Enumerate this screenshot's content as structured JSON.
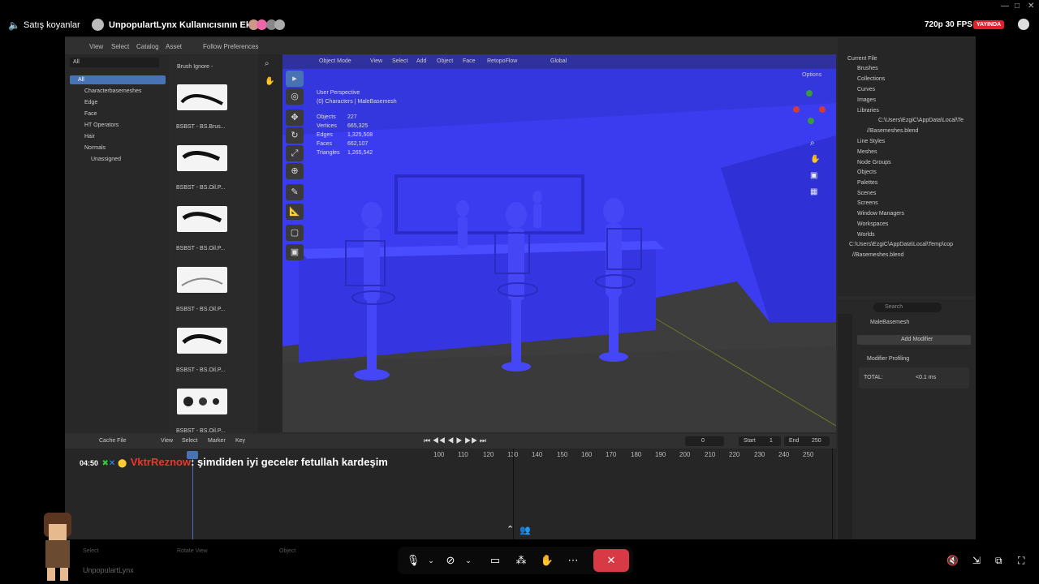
{
  "stream": {
    "audio_label": "Satış koyanlar",
    "screen_title": "UnpopulartLynx Kullanıcısının Ekranı",
    "quality": "720p 30 FPS",
    "live_badge": "YAYINDA"
  },
  "blender": {
    "top_menu": [
      "View",
      "Select",
      "Catalog",
      "Asset"
    ],
    "follow_prefs": "Follow Preferences",
    "filter_value": "All",
    "brush_ignore": "Brush Ignore -",
    "catalog_items": [
      "All",
      "Characterbasemeshes",
      "Edge",
      "Face",
      "HT Operators",
      "Hair",
      "Normals",
      "Unassigned"
    ],
    "brushes": [
      "BSBST - BS.Brus...",
      "BSBST - BS.Oil.P...",
      "BSBST - BS.Oil.P...",
      "BSBST - BS.Oil.P...",
      "BSBST - BS.Oil.P...",
      "BSBST - BS.Oil.P..."
    ],
    "viewport_header": [
      "Object Mode",
      "View",
      "Select",
      "Add",
      "Object",
      "Face",
      "RetopoFlow",
      "Global",
      "Options"
    ],
    "overlay": {
      "perspective": "User Perspective",
      "collection": "(0) Characters | MaleBasemesh",
      "stats": [
        {
          "label": "Objects",
          "value": "227"
        },
        {
          "label": "Vertices",
          "value": "665,325"
        },
        {
          "label": "Edges",
          "value": "1,325,508"
        },
        {
          "label": "Faces",
          "value": "662,107"
        },
        {
          "label": "Triangles",
          "value": "1,265,542"
        }
      ]
    },
    "outliner_title": "Current File",
    "outliner_items": [
      "Brushes",
      "Collections",
      "Curves",
      "Images",
      "Libraries",
      "C:\\Users\\EzgiC\\AppData\\Local\\Te",
      "//Basemeshes.blend",
      "Line Styles",
      "Meshes",
      "Node Groups",
      "Objects",
      "Palettes",
      "Scenes",
      "Screens",
      "Window Managers",
      "Workspaces",
      "Worlds",
      "C:\\Users\\EzgiC\\AppData\\Local\\Temp\\cop",
      "//Basemeshes.blend"
    ],
    "props": {
      "search_placeholder": "Search",
      "object_name": "MaleBasemesh",
      "add_modifier": "Add Modifier",
      "modifier_profiling": "Modifier Profiling",
      "total_label": "TOTAL:",
      "total_value": "<0.1 ms"
    },
    "timeline": {
      "cache_file": "Cache File",
      "menu": [
        "View",
        "Select",
        "Marker",
        "Key"
      ],
      "current_frame": "0",
      "start_label": "Start",
      "start_value": "1",
      "end_label": "End",
      "end_value": "250",
      "ticks": [
        "0",
        "100",
        "110",
        "120",
        "130",
        "140",
        "150",
        "160",
        "170",
        "180",
        "190",
        "200",
        "210",
        "220",
        "230",
        "240",
        "250"
      ]
    },
    "status_bar": [
      "Select",
      "Rotate View",
      "Object"
    ],
    "username_bottom": "UnpopulartLynx"
  },
  "chat": {
    "time": "04:50",
    "username": "VktrReznow",
    "message": ": şimdiden iyi geceler fetullah kardeşim"
  },
  "colors": {
    "viewport_blue": "#3b3cf0",
    "accent_blue": "#4772b3",
    "live_red": "#e0202d",
    "chat_name": "#e8382c",
    "end_call": "#d73a45"
  }
}
